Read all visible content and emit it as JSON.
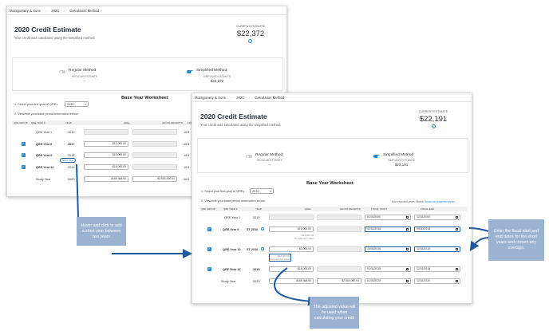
{
  "breadcrumb": {
    "company": "Montgomery & Sons",
    "year": "2020",
    "page": "Calculation Method"
  },
  "header": {
    "title": "2020 Credit Estimate",
    "subtitle": "Your credit was calculated using the simplified method.",
    "current_label": "CURRENT ESTIMATE"
  },
  "back": {
    "current_value": "$22,372"
  },
  "front": {
    "current_value": "$22,191"
  },
  "methods": {
    "regular_name": "Regular Method",
    "regular_sub": "REGULAR ESTIMATE",
    "regular_val": "–",
    "simplified_name": "Simplified Method",
    "simplified_sub": "SIMPLIFIED ESTIMATE",
    "back_simplified_val": "$22,372",
    "front_simplified_val": "$23,191"
  },
  "worksheet": {
    "title": "Base Year Worksheet",
    "select_label": "1. Select your first year of QREs",
    "back_select_value": "2030",
    "front_select_value": "2010",
    "view_label": "2. View/edit your base period information below.",
    "hidden_note": "Non-required years hidden",
    "show_link": "Show non-required years",
    "columns": [
      "QRE GROUP",
      "QRE YEAR #",
      "YEAR",
      "QREs",
      "GROSS RECEIPTS",
      "FISCAL START",
      "FISCAL END"
    ]
  },
  "back_rows": [
    {
      "label": "QRE Year 1",
      "year": "2010",
      "qre": "",
      "checked": false
    },
    {
      "label": "QRE Year 8",
      "year": "2017",
      "qre": "$10,000.00",
      "checked": true
    },
    {
      "label": "QRE Year 9",
      "year": "2018",
      "qre": "$15,000.00",
      "checked": true
    },
    {
      "label": "QRE Year 10",
      "year": "2019",
      "qre": "$18,000.00",
      "checked": true
    },
    {
      "label": "Study Year",
      "year": "2020",
      "qre": "$165,364.00",
      "gross": "$2,500,000.00",
      "checked": false
    }
  ],
  "back_partial_cell": "10/1",
  "short_tag": "Short Year",
  "front_rows": [
    {
      "label": "QRE Year 1",
      "year": "2010",
      "qre": "",
      "start": "01/01/2000",
      "end": "12/31/2000",
      "checked": false
    },
    {
      "label": "QRE Year 9",
      "year": "ST 2016",
      "qre": "$15,000.00",
      "note1": "$15,000.00",
      "note2": "ST adjusted value",
      "start": "01/01/2016",
      "end": "09/30/2016",
      "checked": true
    },
    {
      "label": "QRE Year 10",
      "year": "ST 2016",
      "qre": "$3,000.00",
      "note1": "$12,000.00",
      "note2": "ST adjusted value",
      "start": "10/01/2016",
      "end": "12/31/2016",
      "checked": true
    },
    {
      "label": "QRE Year 11",
      "year": "2018",
      "qre": "$18,000.00",
      "start": "01/01/2018",
      "end": "12/31/2018",
      "checked": true
    },
    {
      "label": "Study Year",
      "year": "2020",
      "qre": "$165,364.00",
      "gross": "$2,500,000.00",
      "start": "01/01/2020",
      "end": "12/31/2020",
      "checked": false
    }
  ],
  "callouts": {
    "hover": "Hover and click to add a short year between two years",
    "dates": "Enter the fiscal start and end dates for the short years and correct any overlaps.",
    "adjusted": "The adjusted value will be used when calculating your credit"
  },
  "colors": {
    "accent": "#1e88c7",
    "callout_bg": "#9bb3d1",
    "highlight": "#1e5aa0"
  }
}
